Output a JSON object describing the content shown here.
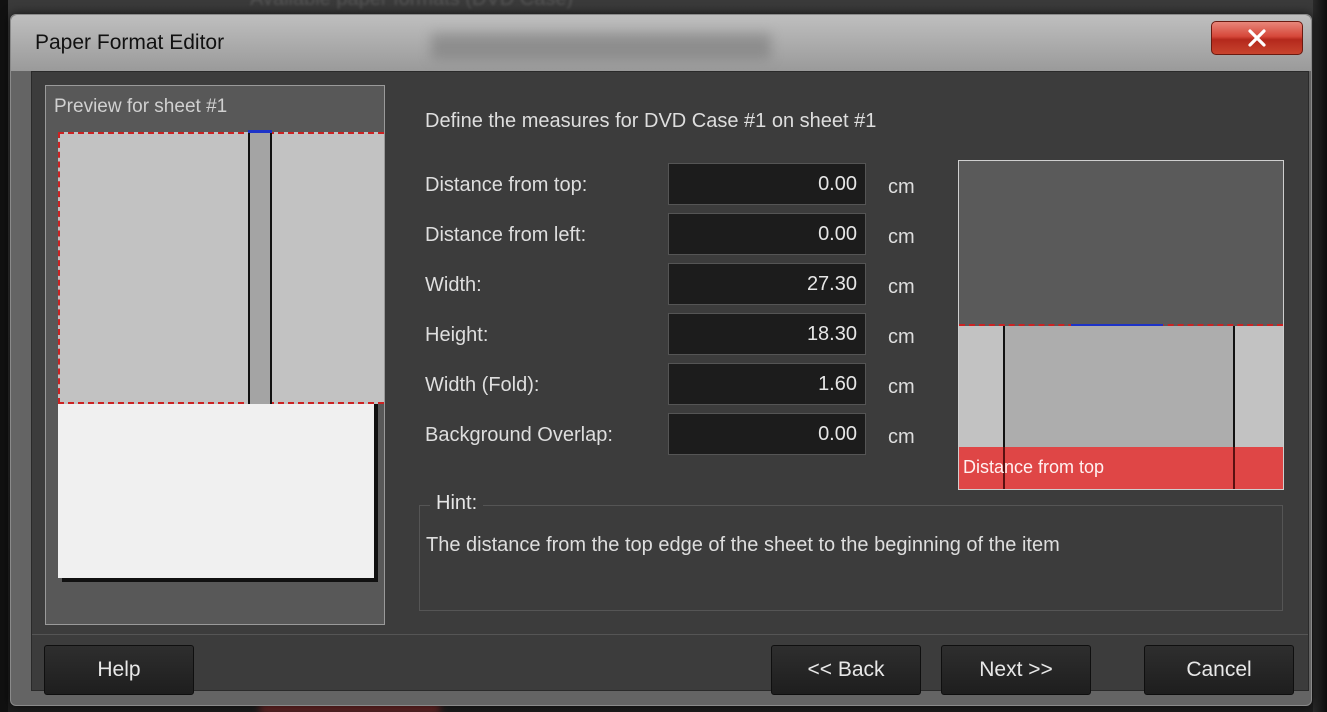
{
  "background": {
    "top_text": "Available paper formats (DVD Case)"
  },
  "window": {
    "title": "Paper Format Editor",
    "close_icon": "close-x-icon",
    "close_glyph": "✕"
  },
  "preview": {
    "label": "Preview for sheet #1"
  },
  "form": {
    "heading": "Define the measures for DVD Case #1 on sheet #1",
    "fields": [
      {
        "label": "Distance from top:",
        "value": "0.00",
        "unit": "cm"
      },
      {
        "label": "Distance from left:",
        "value": "0.00",
        "unit": "cm"
      },
      {
        "label": "Width:",
        "value": "27.30",
        "unit": "cm"
      },
      {
        "label": "Height:",
        "value": "18.30",
        "unit": "cm"
      },
      {
        "label": "Width (Fold):",
        "value": "1.60",
        "unit": "cm"
      },
      {
        "label": "Background Overlap:",
        "value": "0.00",
        "unit": "cm"
      }
    ]
  },
  "diagram": {
    "caption": "Distance from top",
    "highlight_color": "#df4646"
  },
  "hint": {
    "title": "Hint:",
    "text": "The distance from the top edge of the sheet to the beginning of the item"
  },
  "buttons": {
    "help": "Help",
    "back": "<< Back",
    "next": "Next >>",
    "cancel": "Cancel"
  },
  "colors": {
    "dashed_line": "#cc2222",
    "fold_marker": "#1d33c8"
  }
}
